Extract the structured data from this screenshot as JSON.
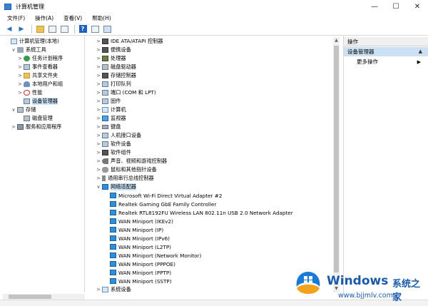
{
  "window": {
    "title": "计算机管理",
    "controls": {
      "minimize": "—",
      "maximize": "☐",
      "close": "✕"
    }
  },
  "menu": [
    "文件(F)",
    "操作(A)",
    "查看(V)",
    "帮助(H)"
  ],
  "left_tree": [
    {
      "label": "计算机管理(本地)",
      "expander": "",
      "icon": "computer-icon",
      "indent": 0
    },
    {
      "label": "系统工具",
      "expander": "∨",
      "icon": "tools-icon",
      "indent": 1
    },
    {
      "label": "任务计划程序",
      "expander": ">",
      "icon": "clock-icon",
      "indent": 2
    },
    {
      "label": "事件查看器",
      "expander": ">",
      "icon": "event-viewer-icon",
      "indent": 2
    },
    {
      "label": "共享文件夹",
      "expander": ">",
      "icon": "shared-folder-icon",
      "indent": 2
    },
    {
      "label": "本地用户和组",
      "expander": ">",
      "icon": "users-icon",
      "indent": 2
    },
    {
      "label": "性能",
      "expander": ">",
      "icon": "performance-icon",
      "indent": 2
    },
    {
      "label": "设备管理器",
      "expander": "",
      "icon": "device-manager-icon",
      "indent": 2,
      "selected": true
    },
    {
      "label": "存储",
      "expander": "∨",
      "icon": "storage-icon",
      "indent": 1
    },
    {
      "label": "磁盘管理",
      "expander": "",
      "icon": "disk-icon",
      "indent": 2
    },
    {
      "label": "服务和应用程序",
      "expander": ">",
      "icon": "services-icon",
      "indent": 1
    }
  ],
  "device_tree": [
    {
      "label": "IDE ATA/ATAPI 控制器",
      "expander": ">",
      "icon": "ide-icon",
      "indent": 0
    },
    {
      "label": "便携设备",
      "expander": ">",
      "icon": "portable-device-icon",
      "indent": 0
    },
    {
      "label": "处理器",
      "expander": ">",
      "icon": "processor-icon",
      "indent": 0
    },
    {
      "label": "磁盘驱动器",
      "expander": ">",
      "icon": "disk-drive-icon",
      "indent": 0
    },
    {
      "label": "存储控制器",
      "expander": ">",
      "icon": "storage-controller-icon",
      "indent": 0
    },
    {
      "label": "打印队列",
      "expander": ">",
      "icon": "printer-icon",
      "indent": 0
    },
    {
      "label": "端口 (COM 和 LPT)",
      "expander": ">",
      "icon": "port-icon",
      "indent": 0
    },
    {
      "label": "固件",
      "expander": ">",
      "icon": "firmware-icon",
      "indent": 0
    },
    {
      "label": "计算机",
      "expander": ">",
      "icon": "computer-icon",
      "indent": 0
    },
    {
      "label": "监视器",
      "expander": ">",
      "icon": "monitor-icon",
      "indent": 0
    },
    {
      "label": "键盘",
      "expander": ">",
      "icon": "keyboard-icon",
      "indent": 0
    },
    {
      "label": "人机接口设备",
      "expander": ">",
      "icon": "hid-icon",
      "indent": 0
    },
    {
      "label": "软件设备",
      "expander": ">",
      "icon": "software-device-icon",
      "indent": 0
    },
    {
      "label": "软件组件",
      "expander": ">",
      "icon": "software-component-icon",
      "indent": 0
    },
    {
      "label": "声音、视频和游戏控制器",
      "expander": ">",
      "icon": "sound-icon",
      "indent": 0
    },
    {
      "label": "鼠标和其他指针设备",
      "expander": ">",
      "icon": "mouse-icon",
      "indent": 0
    },
    {
      "label": "通用串行总线控制器",
      "expander": ">",
      "icon": "usb-icon",
      "indent": 0
    },
    {
      "label": "网络适配器",
      "expander": "∨",
      "icon": "network-adapter-icon",
      "indent": 0,
      "selected": true
    },
    {
      "label": "Microsoft Wi-Fi Direct Virtual Adapter #2",
      "expander": "",
      "icon": "network-adapter-icon",
      "indent": 1
    },
    {
      "label": "Realtek Gaming GbE Family Controller",
      "expander": "",
      "icon": "network-adapter-icon",
      "indent": 1
    },
    {
      "label": "Realtek RTL8192FU Wireless LAN 802.11n USB 2.0 Network Adapter",
      "expander": "",
      "icon": "network-adapter-icon",
      "indent": 1
    },
    {
      "label": "WAN Miniport (IKEv2)",
      "expander": "",
      "icon": "network-adapter-icon",
      "indent": 1
    },
    {
      "label": "WAN Miniport (IP)",
      "expander": "",
      "icon": "network-adapter-icon",
      "indent": 1
    },
    {
      "label": "WAN Miniport (IPv6)",
      "expander": "",
      "icon": "network-adapter-icon",
      "indent": 1
    },
    {
      "label": "WAN Miniport (L2TP)",
      "expander": "",
      "icon": "network-adapter-icon",
      "indent": 1
    },
    {
      "label": "WAN Miniport (Network Monitor)",
      "expander": "",
      "icon": "network-adapter-icon",
      "indent": 1
    },
    {
      "label": "WAN Miniport (PPPOE)",
      "expander": "",
      "icon": "network-adapter-icon",
      "indent": 1
    },
    {
      "label": "WAN Miniport (PPTP)",
      "expander": "",
      "icon": "network-adapter-icon",
      "indent": 1
    },
    {
      "label": "WAN Miniport (SSTP)",
      "expander": "",
      "icon": "network-adapter-icon",
      "indent": 1
    },
    {
      "label": "系统设备",
      "expander": ">",
      "icon": "system-device-icon",
      "indent": 0
    }
  ],
  "actions": {
    "header": "操作",
    "section": "设备管理器",
    "more": "更多操作",
    "section_caret": "▲",
    "more_arrow": "▶"
  },
  "watermark": {
    "brand": "Windows",
    "cn": "系统之家",
    "url": "www.bjjmlv.com"
  },
  "colors": {
    "selection": "#cce4f7",
    "accent": "#1a5aa8"
  }
}
